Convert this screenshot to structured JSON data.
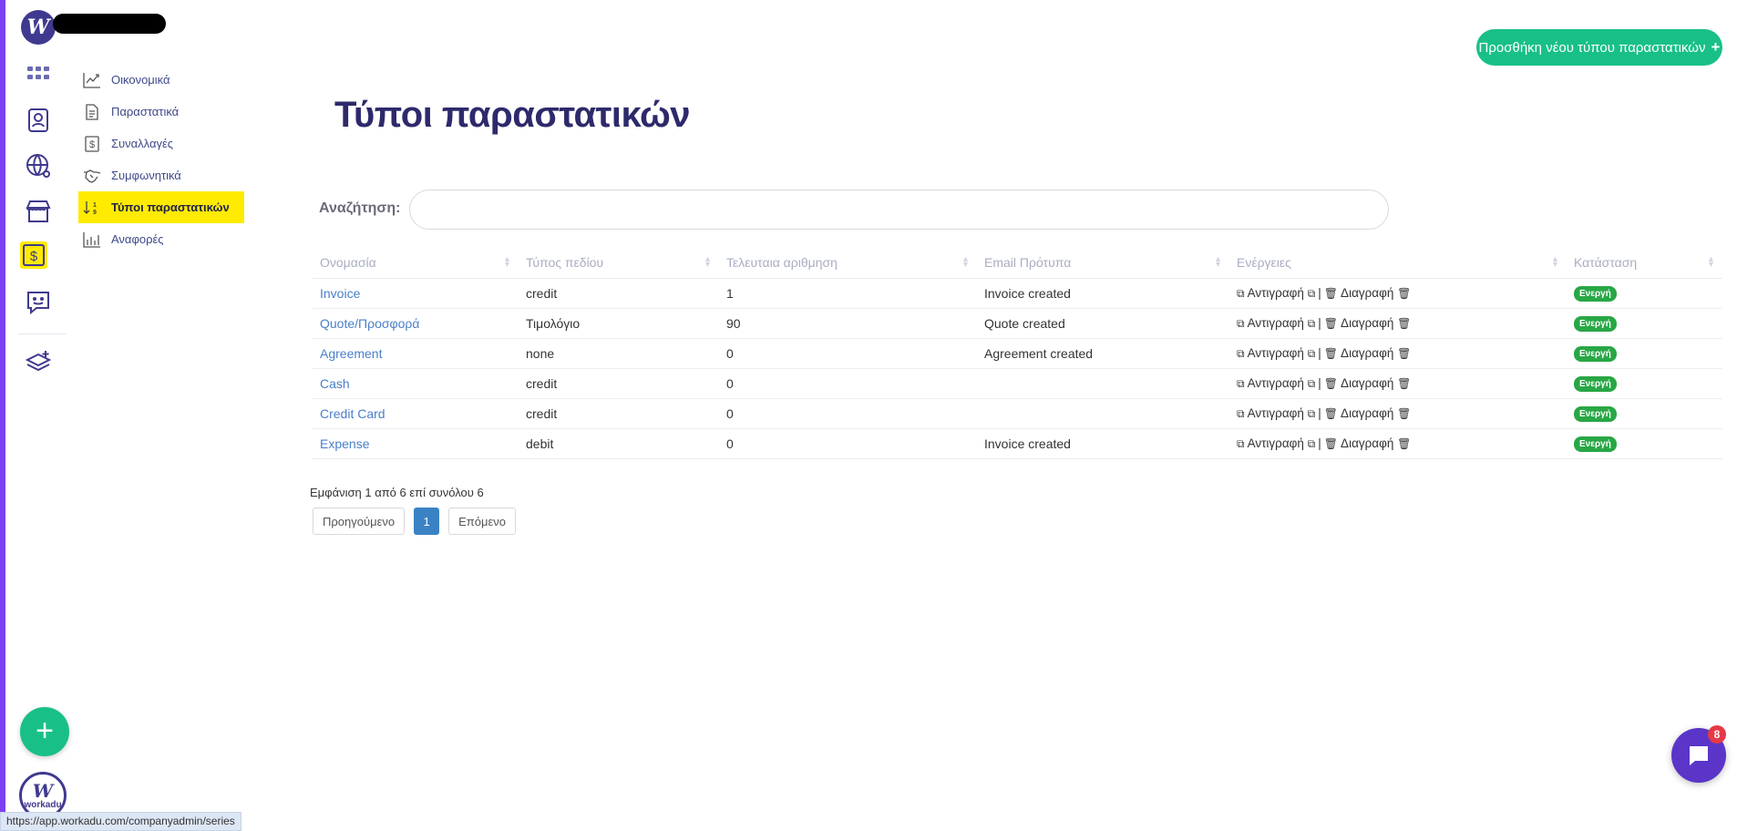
{
  "colors": {
    "accent": "#18c088",
    "rail_border": "#7b3ff2",
    "title": "#2d2a6b",
    "link": "#4a7fc8",
    "highlight": "#ffeb00",
    "status": "#28a745"
  },
  "rail": {
    "icons": [
      "apps-grid-icon",
      "contacts-icon",
      "globe-settings-icon",
      "store-icon",
      "dollar-icon",
      "chat-smile-icon",
      "layers-add-icon"
    ],
    "logo_letter": "W",
    "bottom_logo_text": "workadu"
  },
  "submenu": {
    "items": [
      {
        "label": "Οικονομικά",
        "icon": "chart-line-icon"
      },
      {
        "label": "Παραστατικά",
        "icon": "document-icon"
      },
      {
        "label": "Συναλλαγές",
        "icon": "dollar-box-icon"
      },
      {
        "label": "Συμφωνητικά",
        "icon": "handshake-icon"
      },
      {
        "label": "Τύποι παραστατικών",
        "icon": "sort-numeric-icon",
        "active": true
      },
      {
        "label": "Αναφορές",
        "icon": "bar-chart-icon"
      }
    ]
  },
  "header": {
    "title": "Τύποι παραστατικών",
    "add_button": "Προσθήκη νέου τύπου παραστατικών",
    "add_button_icon": "+"
  },
  "search": {
    "label": "Αναζήτηση:",
    "value": "",
    "placeholder": ""
  },
  "table": {
    "columns": [
      "Ονομασία",
      "Τύπος πεδίου",
      "Τελευταια αριθμηση",
      "Email Πρότυπα",
      "Ενέργειες",
      "Κατάσταση"
    ],
    "action_copy": "Αντιγραφή",
    "action_delete": "Διαγραφή",
    "action_sep": "|",
    "rows": [
      {
        "name": "Invoice",
        "type": "credit",
        "last": "1",
        "email": "Invoice created",
        "status": "Ενεργή"
      },
      {
        "name": "Quote/Προσφορά",
        "type": "Τιμολόγιο",
        "last": "90",
        "email": "Quote created",
        "status": "Ενεργή"
      },
      {
        "name": "Agreement",
        "type": "none",
        "last": "0",
        "email": "Agreement created",
        "status": "Ενεργή"
      },
      {
        "name": "Cash",
        "type": "credit",
        "last": "0",
        "email": "",
        "status": "Ενεργή"
      },
      {
        "name": "Credit Card",
        "type": "credit",
        "last": "0",
        "email": "",
        "status": "Ενεργή"
      },
      {
        "name": "Expense",
        "type": "debit",
        "last": "0",
        "email": "Invoice created",
        "status": "Ενεργή"
      }
    ]
  },
  "pagination": {
    "info": "Εμφάνιση 1 από 6 επί συνόλου 6",
    "prev": "Προηγούμενο",
    "current": "1",
    "next": "Επόμενο"
  },
  "chat": {
    "badge_count": "8"
  },
  "status_bar": {
    "url": "https://app.workadu.com/companyadmin/series"
  },
  "fab": {
    "label": "+"
  }
}
